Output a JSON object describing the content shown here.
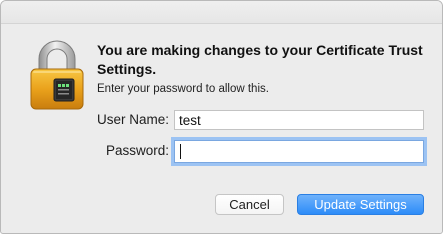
{
  "dialog": {
    "title": "You are making changes to your Certificate Trust Settings.",
    "message": "Enter your password to allow this."
  },
  "form": {
    "username_label": "User Name:",
    "username_value": "test",
    "password_label": "Password:",
    "password_value": ""
  },
  "buttons": {
    "cancel_label": "Cancel",
    "update_label": "Update Settings"
  },
  "colors": {
    "window_background": "#ececec",
    "lock_gold": "#e9a11c",
    "primary_button": "#2d8cf8",
    "focus_ring": "#9cc3f3"
  },
  "icons": {
    "dialog_icon": "padlock-keychain-icon"
  }
}
